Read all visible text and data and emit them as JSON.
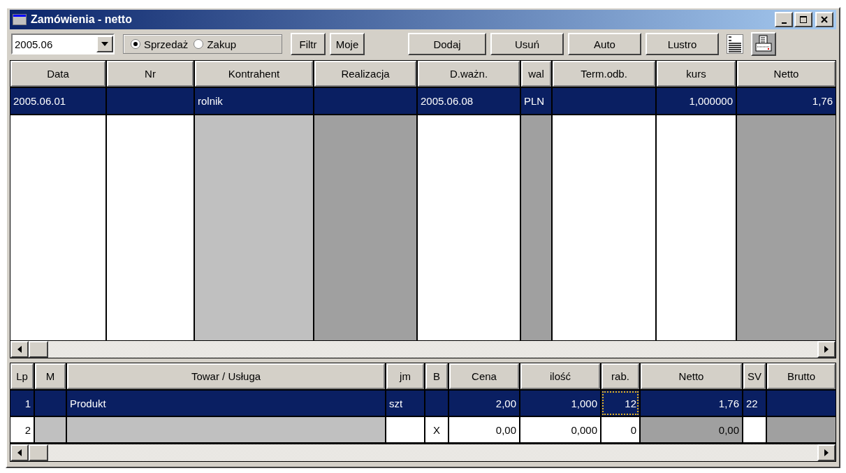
{
  "window": {
    "title": "Zamówienia - netto"
  },
  "toolbar": {
    "period": {
      "value": "2005.06"
    },
    "mode": [
      {
        "label": "Sprzedaż",
        "selected": true
      },
      {
        "label": "Zakup",
        "selected": false
      }
    ],
    "filter_buttons": [
      "Filtr",
      "Moje"
    ],
    "action_buttons": [
      "Dodaj",
      "Usuń",
      "Auto",
      "Lustro"
    ]
  },
  "orders": {
    "columns": [
      {
        "label": "Data",
        "kind": "text",
        "color": "#ffffff"
      },
      {
        "label": "Nr",
        "kind": "text",
        "color": "#ffffff"
      },
      {
        "label": "Kontrahent",
        "kind": "text",
        "color": "#c0c0c0"
      },
      {
        "label": "Realizacja",
        "kind": "text",
        "color": "#a0a0a0"
      },
      {
        "label": "D.ważn.",
        "kind": "text",
        "color": "#ffffff"
      },
      {
        "label": "wal",
        "kind": "text",
        "color": "#a0a0a0"
      },
      {
        "label": "Term.odb.",
        "kind": "text",
        "color": "#ffffff"
      },
      {
        "label": "kurs",
        "kind": "number",
        "color": "#ffffff"
      },
      {
        "label": "Netto",
        "kind": "number",
        "color": "#a0a0a0"
      }
    ],
    "rows": [
      {
        "selected": true,
        "cells": [
          "2005.06.01",
          null,
          "rolnik",
          null,
          "2005.06.08",
          "PLN",
          null,
          "1,000000",
          "1,76"
        ]
      }
    ]
  },
  "items": {
    "columns": [
      {
        "label": "Lp",
        "kind": "number"
      },
      {
        "label": "M",
        "kind": "text"
      },
      {
        "label": "Towar / Usługa",
        "kind": "text"
      },
      {
        "label": "jm",
        "kind": "text"
      },
      {
        "label": "B",
        "kind": "flag"
      },
      {
        "label": "Cena",
        "kind": "number"
      },
      {
        "label": "ilość",
        "kind": "number"
      },
      {
        "label": "rab.",
        "kind": "number"
      },
      {
        "label": "Netto",
        "kind": "number"
      },
      {
        "label": "SV",
        "kind": "text"
      },
      {
        "label": "Brutto",
        "kind": "number"
      }
    ],
    "rows": [
      {
        "selected": true,
        "cells": [
          {
            "text": "1",
            "focused": false
          },
          {
            "focused": false
          },
          {
            "text": "Produkt",
            "focused": false
          },
          {
            "text": "szt",
            "focused": false
          },
          {
            "focused": false
          },
          {
            "text": "2,00",
            "focused": false
          },
          {
            "text": "1,000",
            "focused": false
          },
          {
            "text": "12",
            "focused": true
          },
          {
            "text": "1,76",
            "focused": false
          },
          {
            "text": "22",
            "focused": false
          },
          {
            "focused": false
          }
        ]
      },
      {
        "selected": false,
        "cells": [
          {
            "text": "2",
            "color": "#ffffff",
            "focused": false
          },
          {
            "color": "#c0c0c0",
            "focused": false
          },
          {
            "color": "#c0c0c0",
            "focused": false
          },
          {
            "color": "#ffffff",
            "focused": false
          },
          {
            "text": "X",
            "color": "#ffffff",
            "focused": false
          },
          {
            "text": "0,00",
            "color": "#ffffff",
            "focused": false
          },
          {
            "text": "0,000",
            "color": "#ffffff",
            "focused": false
          },
          {
            "text": "0",
            "color": "#ffffff",
            "focused": false
          },
          {
            "text": "0,00",
            "color": "#a0a0a0",
            "focused": false
          },
          {
            "color": "#ffffff",
            "focused": false
          },
          {
            "color": "#a0a0a0",
            "focused": false
          }
        ]
      }
    ]
  }
}
